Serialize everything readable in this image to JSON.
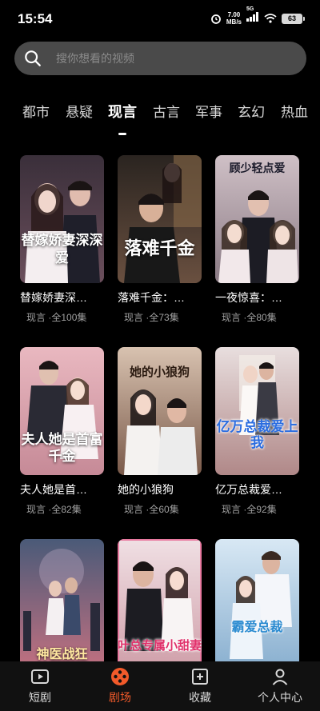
{
  "status": {
    "time": "15:54",
    "net_speed_value": "7.00",
    "net_speed_unit": "MB/s",
    "signal": "5G",
    "battery": "63"
  },
  "search": {
    "placeholder": "搜你想看的视频"
  },
  "tabs": [
    {
      "label": "都市",
      "active": false
    },
    {
      "label": "悬疑",
      "active": false
    },
    {
      "label": "现言",
      "active": true
    },
    {
      "label": "古言",
      "active": false
    },
    {
      "label": "军事",
      "active": false
    },
    {
      "label": "玄幻",
      "active": false
    },
    {
      "label": "热血",
      "active": false
    }
  ],
  "dramas": [
    {
      "title": "替嫁娇妻深…",
      "genre": "现言",
      "episodes": "·全100集",
      "poster_text": "替嫁娇妻深深爱",
      "colors": [
        "#3a2f3a",
        "#6b4f5c"
      ]
    },
    {
      "title": "落难千金：…",
      "genre": "现言",
      "episodes": "·全73集",
      "poster_text": "落难千金",
      "colors": [
        "#2a2420",
        "#6a5040"
      ]
    },
    {
      "title": "一夜惊喜：…",
      "genre": "现言",
      "episodes": "·全80集",
      "poster_text": "顾少轻点爱",
      "colors": [
        "#cfc0c6",
        "#8a7a84"
      ]
    },
    {
      "title": "夫人她是首…",
      "genre": "现言",
      "episodes": "·全82集",
      "poster_text": "夫人她是首富千金",
      "colors": [
        "#e9b8c0",
        "#c68a97"
      ]
    },
    {
      "title": "她的小狼狗",
      "genre": "现言",
      "episodes": "·全60集",
      "poster_text": "她的小狼狗",
      "colors": [
        "#d8c2b0",
        "#7a5a4a"
      ]
    },
    {
      "title": "亿万总裁爱…",
      "genre": "现言",
      "episodes": "·全92集",
      "poster_text": "亿万总裁爱上我",
      "colors": [
        "#e8dede",
        "#b08888"
      ]
    },
    {
      "title": "",
      "genre": "",
      "episodes": "",
      "poster_text": "神医战狂",
      "colors": [
        "#4a5a78",
        "#c07080"
      ]
    },
    {
      "title": "",
      "genre": "",
      "episodes": "",
      "poster_text": "叶总专属小甜妻",
      "colors": [
        "#f0e0e4",
        "#d0a0aa"
      ]
    },
    {
      "title": "",
      "genre": "",
      "episodes": "",
      "poster_text": "霸爱总裁",
      "colors": [
        "#d8e8f4",
        "#8ab0d0"
      ]
    }
  ],
  "nav": [
    {
      "label": "短剧",
      "icon": "play-square-icon",
      "active": false
    },
    {
      "label": "剧场",
      "icon": "film-reel-icon",
      "active": true
    },
    {
      "label": "收藏",
      "icon": "add-collection-icon",
      "active": false
    },
    {
      "label": "个人中心",
      "icon": "person-icon",
      "active": false
    }
  ],
  "accent_color": "#f25a2a"
}
